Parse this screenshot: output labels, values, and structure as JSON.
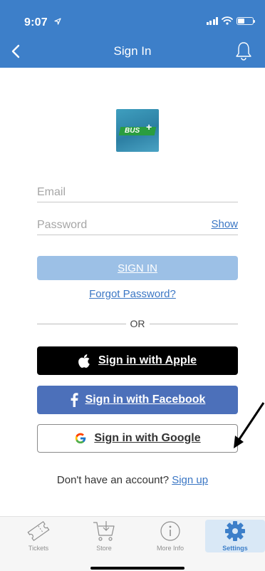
{
  "status_bar": {
    "time": "9:07"
  },
  "nav": {
    "title": "Sign In"
  },
  "form": {
    "email_placeholder": "Email",
    "password_placeholder": "Password",
    "show_label": "Show",
    "signin_label": "SIGN IN",
    "forgot_label": "Forgot Password?",
    "or_label": "OR"
  },
  "social": {
    "apple_label": "Sign in with Apple",
    "facebook_label": "Sign in with Facebook",
    "google_label": "Sign in with Google"
  },
  "signup": {
    "prompt": "Don't have an account?",
    "link": "Sign up"
  },
  "tabs": [
    {
      "label": "Tickets"
    },
    {
      "label": "Store"
    },
    {
      "label": "More Info"
    },
    {
      "label": "Settings"
    }
  ],
  "logo_text": "BUS",
  "colors": {
    "header": "#3d7fc9",
    "signin_disabled": "#9cc0e6",
    "facebook": "#4c70ba",
    "link": "#3a76c4"
  }
}
